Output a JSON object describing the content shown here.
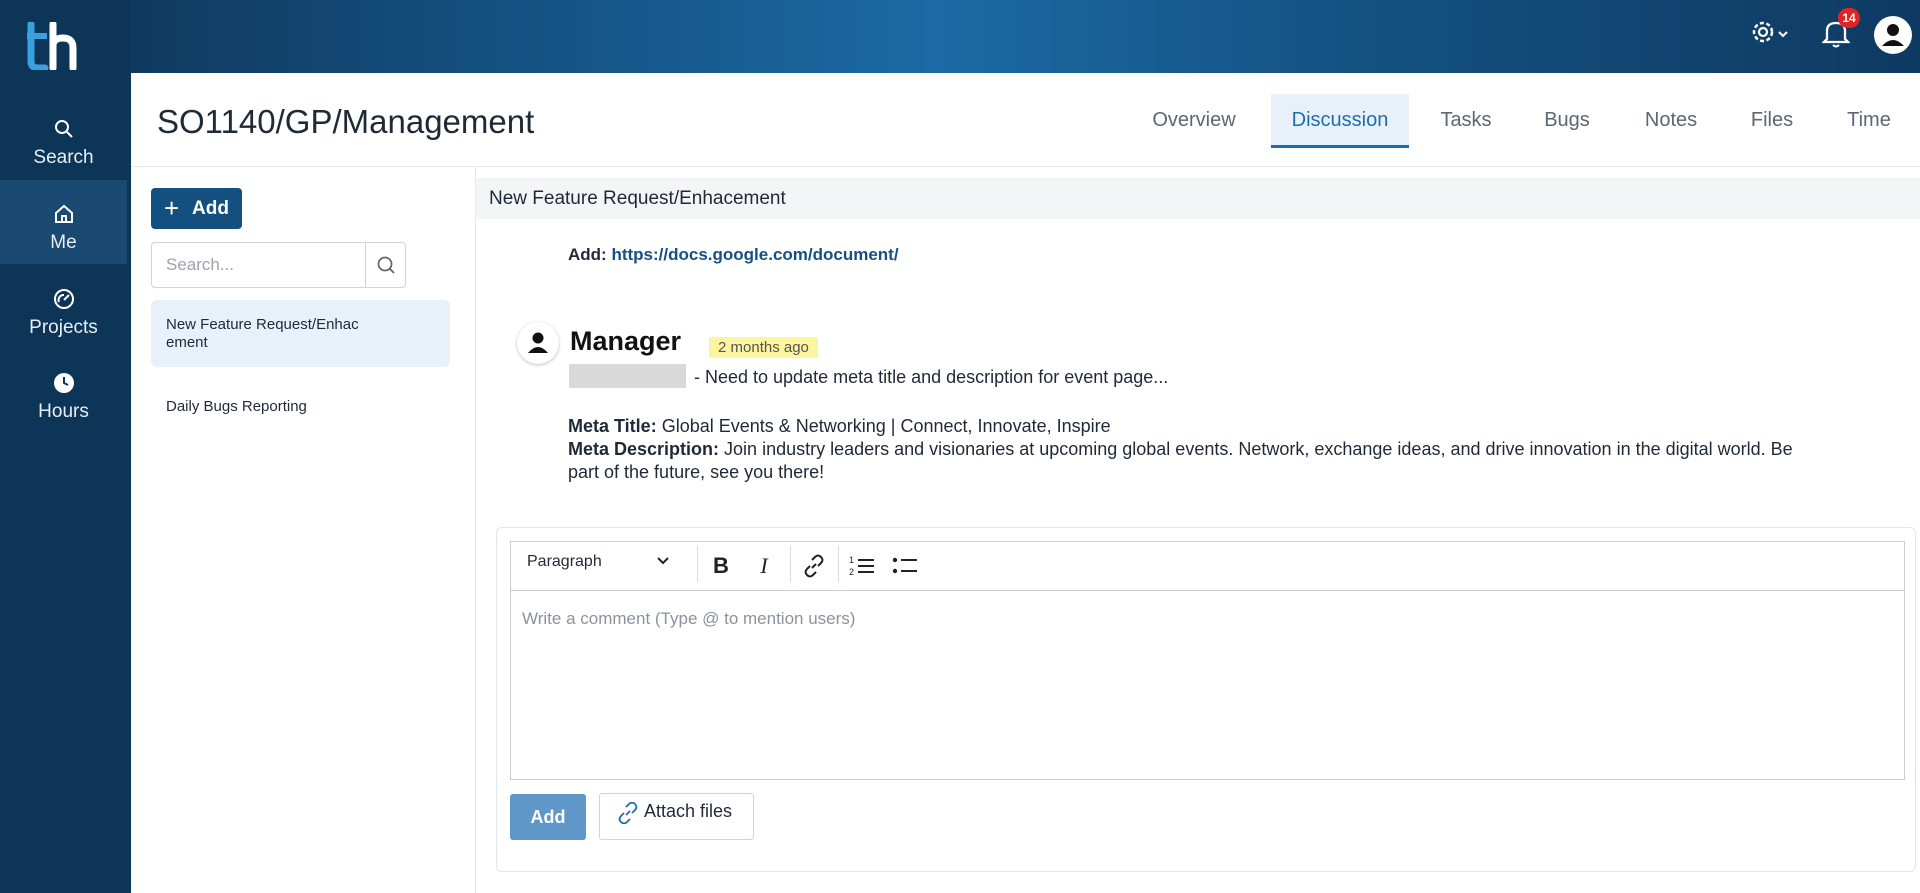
{
  "nav": {
    "items": [
      {
        "label": "Search",
        "icon": "search-icon"
      },
      {
        "label": "Me",
        "icon": "home-icon"
      },
      {
        "label": "Projects",
        "icon": "dashboard-icon"
      },
      {
        "label": "Hours",
        "icon": "clock-icon"
      }
    ]
  },
  "topbar": {
    "notification_count": "14"
  },
  "header": {
    "title": "SO1140/GP/Management",
    "tabs": [
      "Overview",
      "Discussion",
      "Tasks",
      "Bugs",
      "Notes",
      "Files",
      "Time"
    ],
    "active_tab": "Discussion"
  },
  "list_panel": {
    "add_label": "Add",
    "search_placeholder": "Search...",
    "items": [
      {
        "title": "New Feature Request/Enhac ement",
        "line1": "New Feature Request/Enhac",
        "line2": "ement"
      },
      {
        "title": "Daily Bugs Reporting"
      }
    ]
  },
  "discussion": {
    "title": "New Feature Request/Enhacement",
    "add_prefix": "Add:",
    "link": "https://docs.google.com/document/",
    "comment": {
      "author": "Manager",
      "time": "2 months ago",
      "message": "- Need to update meta title and description for event page...",
      "meta_title_label": "Meta Title:",
      "meta_title": "Global Events & Networking | Connect, Innovate, Inspire",
      "meta_desc_label": "Meta Description:",
      "meta_desc": "Join industry leaders and visionaries at upcoming global events. Network, exchange ideas, and drive innovation in the digital world. Be part of the future, see you there!"
    }
  },
  "editor": {
    "format_value": "Paragraph",
    "placeholder": "Write a comment (Type @ to mention users)",
    "submit_label": "Add",
    "attach_label": "Attach files"
  }
}
